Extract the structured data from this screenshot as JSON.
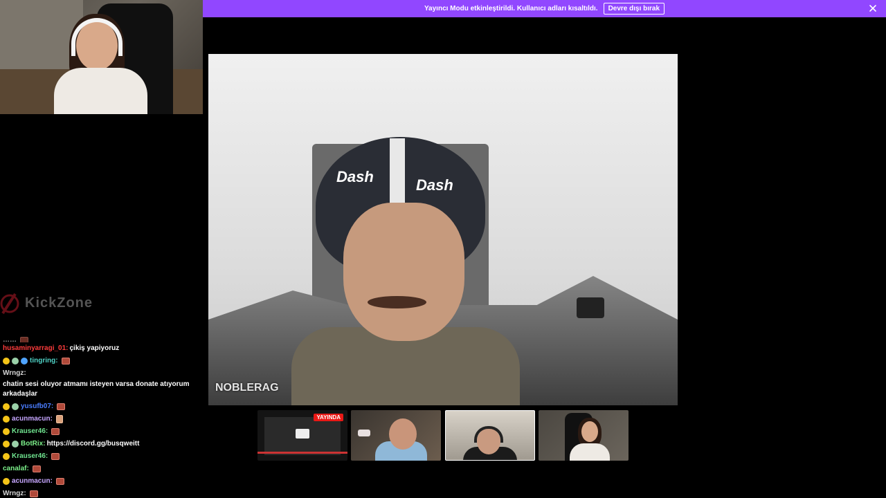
{
  "banner": {
    "message": "Yayıncı Modu etkinleştirildi. Kullanıcı adları kısaltıldı.",
    "disable_label": "Devre dışı bırak",
    "bg_color": "#9147ff"
  },
  "sponsor": {
    "text": "KickZone"
  },
  "chat": {
    "messages": [
      {
        "user": "……",
        "color": "#ffffff",
        "text": "",
        "emote": true,
        "partial": true
      },
      {
        "user": "husaminyarragi_01:",
        "color": "#ff3c3c",
        "text": "çikiş yapiyoruz"
      },
      {
        "user": "tingring:",
        "color": "#4fd1c5",
        "text": "",
        "emote": true,
        "badges": 3
      },
      {
        "user": "Wrngz:",
        "color": "#d6d6d6",
        "text": "chatin sesi oluyor atmamı isteyen varsa donate atıyorum arkadaşlar"
      },
      {
        "user": "yusufb07:",
        "color": "#4a7dff",
        "text": "",
        "emote": true,
        "badges": 2
      },
      {
        "user": "acunmacun:",
        "color": "#c6a6ff",
        "text": "",
        "emote_flesh": true,
        "badges": 1
      },
      {
        "user": "Krauser46:",
        "color": "#6fe38f",
        "text": "",
        "emote": true,
        "badges": 1
      },
      {
        "user": "BotRix:",
        "color": "#7cf08a",
        "text": "https://discord.gg/busqweitt",
        "badges": 2
      },
      {
        "user": "Krauser46:",
        "color": "#6fe38f",
        "text": "",
        "emote": true,
        "badges": 1
      },
      {
        "user": "canalaf:",
        "color": "#7cf08a",
        "text": "",
        "emote": true
      },
      {
        "user": "acunmacun:",
        "color": "#c6a6ff",
        "text": "",
        "emote": true,
        "badges": 1
      },
      {
        "user": "Wrngz:",
        "color": "#d6d6d6",
        "text": "",
        "emote": true
      }
    ]
  },
  "video": {
    "watermark": "NOBLERAG",
    "helmet_logo_left": "Dash",
    "helmet_logo_right": "Dash"
  },
  "squad": {
    "live_label": "YAYINDA"
  },
  "icons": {
    "close": "close-icon",
    "sponsor": "sponsor-logo-icon"
  }
}
